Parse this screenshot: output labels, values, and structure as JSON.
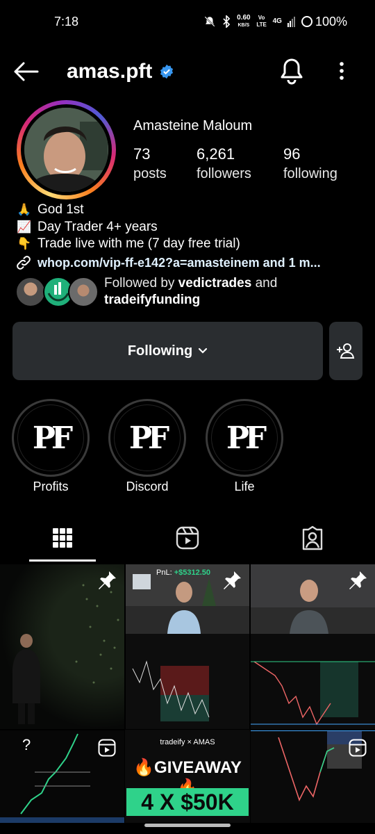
{
  "status_bar": {
    "time": "7:18",
    "net_speed": "0.60",
    "net_unit": "KB/S",
    "volte": "Vo LTE",
    "signal": "4G",
    "battery": "100%"
  },
  "header": {
    "username": "amas.pft",
    "verified": true
  },
  "profile": {
    "full_name": "Amasteine Maloum",
    "stats": [
      {
        "value": "73",
        "label": "posts"
      },
      {
        "value": "6,261",
        "label": "followers"
      },
      {
        "value": "96",
        "label": "following"
      }
    ],
    "bio": [
      {
        "icon": "praying-hands-icon",
        "glyph": "🙏",
        "text": "God 1st"
      },
      {
        "icon": "chart-up-icon",
        "glyph": "📈",
        "text": "Day Trader 4+ years"
      },
      {
        "icon": "pointing-down-icon",
        "glyph": "👇",
        "text": "Trade live with me (7 day free trial)"
      }
    ],
    "link": "whop.com/vip-ff-e142?a=amasteinem and 1 m...",
    "followed_by": {
      "prefix": "Followed by ",
      "user1": "vedictrades",
      "middle": " and",
      "user2": "tradeifyfunding"
    }
  },
  "actions": {
    "following_label": "Following"
  },
  "highlights": [
    {
      "label": "Profits",
      "logo": "PF"
    },
    {
      "label": "Discord",
      "logo": "PF"
    },
    {
      "label": "Life",
      "logo": "PF"
    }
  ],
  "grid": {
    "pnl_label": "PnL: ",
    "pnl_value": "+$5312.50",
    "giveaway_brand": "tradeify  ×  AMAS",
    "giveaway_title": "🔥GIVEAWAY🔥",
    "giveaway_prize": "4 X $50K"
  },
  "colors": {
    "accent_verified": "#3897f0",
    "button_bg": "#2a2d30",
    "giveaway_green": "#2fd28a"
  }
}
